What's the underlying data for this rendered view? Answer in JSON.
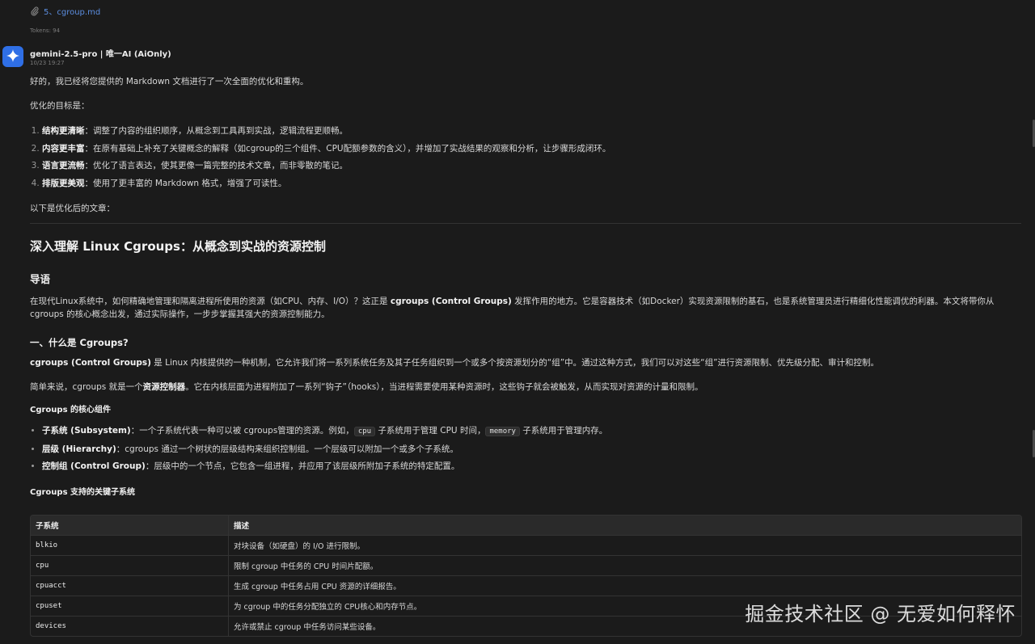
{
  "attachment": {
    "icon": "paperclip-icon",
    "filename": "5、cgroup.md"
  },
  "tokens": "Tokens: 94",
  "message": {
    "avatar_icon": "gemini-sparkle-icon",
    "accent": "#2f6fe6",
    "model": "gemini-2.5-pro | 唯一AI (AiOnly)",
    "time": "10/23 19:27"
  },
  "intro": {
    "p1": "好的，我已经将您提供的 Markdown 文档进行了一次全面的优化和重构。",
    "p2": "优化的目标是：",
    "goals": [
      {
        "bold": "结构更清晰",
        "text": "：调整了内容的组织顺序，从概念到工具再到实战，逻辑流程更顺畅。"
      },
      {
        "bold": "内容更丰富",
        "text": "：在原有基础上补充了关键概念的解释（如cgroup的三个组件、CPU配额参数的含义），并增加了实战结果的观察和分析，让步骤形成闭环。"
      },
      {
        "bold": "语言更流畅",
        "text": "：优化了语言表达，使其更像一篇完整的技术文章，而非零散的笔记。"
      },
      {
        "bold": "排版更美观",
        "text": "：使用了更丰富的 Markdown 格式，增强了可读性。"
      }
    ],
    "p3": "以下是优化后的文章："
  },
  "article": {
    "title": "深入理解 Linux Cgroups：从概念到实战的资源控制",
    "lead_heading": "导语",
    "lead": {
      "t1": "在现代Linux系统中，如何精确地管理和隔离进程所使用的资源（如CPU、内存、I/O）？这正是 ",
      "b1": "cgroups (Control Groups)",
      "t2": " 发挥作用的地方。它是容器技术（如Docker）实现资源限制的基石，也是系统管理员进行精细化性能调优的利器。本文将带你从 cgroups 的核心概念出发，通过实际操作，一步步掌握其强大的资源控制能力。"
    },
    "section1_heading": "一、什么是 Cgroups?",
    "def": {
      "b1": "cgroups (Control Groups)",
      "t1": " 是 Linux 内核提供的一种机制，它允许我们将一系列系统任务及其子任务组织到一个或多个按资源划分的“组”中。通过这种方式，我们可以对这些“组”进行资源限制、优先级分配、审计和控制。"
    },
    "simple": {
      "t1": "简单来说，cgroups 就是一个",
      "b1": "资源控制器",
      "t2": "。它在内核层面为进程附加了一系列“钩子”（hooks），当进程需要使用某种资源时，这些钩子就会被触发，从而实现对资源的计量和限制。"
    },
    "components_heading": "Cgroups 的核心组件",
    "components": [
      {
        "bold": "子系统 (Subsystem)",
        "t1": "：一个子系统代表一种可以被 cgroups管理的资源。例如，",
        "code1": "cpu",
        "t2": " 子系统用于管理 CPU 时间，",
        "code2": "memory",
        "t3": " 子系统用于管理内存。"
      },
      {
        "bold": "层级 (Hierarchy)",
        "t1": "：cgroups 通过一个树状的层级结构来组织控制组。一个层级可以附加一个或多个子系统。"
      },
      {
        "bold": "控制组 (Control Group)",
        "t1": "：层级中的一个节点，它包含一组进程，并应用了该层级所附加子系统的特定配置。"
      }
    ],
    "subsystems_heading": "Cgroups 支持的关键子系统",
    "table": {
      "headers": [
        "子系统",
        "描述"
      ],
      "rows": [
        [
          "blkio",
          "对块设备（如硬盘）的 I/O 进行限制。"
        ],
        [
          "cpu",
          "限制 cgroup 中任务的 CPU 时间片配额。"
        ],
        [
          "cpuacct",
          "生成 cgroup 中任务占用 CPU 资源的详细报告。"
        ],
        [
          "cpuset",
          "为 cgroup 中的任务分配独立的 CPU核心和内存节点。"
        ],
        [
          "devices",
          "允许或禁止 cgroup 中任务访问某些设备。"
        ]
      ]
    }
  },
  "watermark": "掘金技术社区 @ 无爱如何释怀"
}
